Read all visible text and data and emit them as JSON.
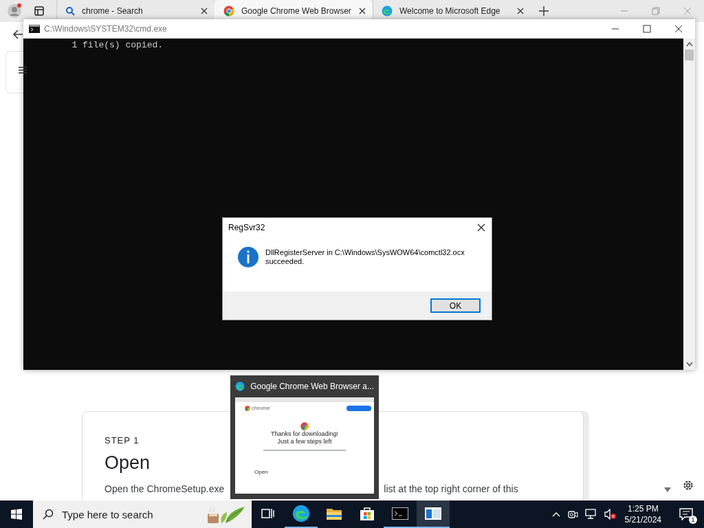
{
  "browser": {
    "tabs": [
      {
        "label": "chrome - Search",
        "kind": "search",
        "selected": false
      },
      {
        "label": "Google Chrome Web Browser",
        "kind": "chrome",
        "selected": true
      },
      {
        "label": "Welcome to Microsoft Edge",
        "kind": "edge",
        "selected": false
      }
    ],
    "page": {
      "step": "STEP 1",
      "heading": "Open",
      "text_left": "Open the ChromeSetup.exe",
      "text_right": "list at the top right corner of this"
    }
  },
  "console": {
    "title": "C:\\Windows\\SYSTEM32\\cmd.exe",
    "lines": [
      "        1 file(s) copied."
    ]
  },
  "dialog": {
    "title": "RegSvr32",
    "message": "DllRegisterServer in C:\\Windows\\SysWOW64\\comctl32.ocx\nsucceeded.",
    "button": "OK"
  },
  "preview": {
    "title": "Google Chrome Web Browser a...",
    "logo": "chrome",
    "headline": [
      "Thanks for downloading!",
      "Just a few steps left"
    ],
    "step": "Open"
  },
  "taskbar": {
    "search": {
      "placeholder": "Type here to search"
    },
    "apps": [
      {
        "kind": "taskview",
        "active": false
      },
      {
        "kind": "edge",
        "active": true
      },
      {
        "kind": "folder",
        "active": false
      },
      {
        "kind": "store",
        "active": false
      },
      {
        "kind": "console",
        "active": true
      },
      {
        "kind": "window",
        "active": true
      }
    ],
    "time": "1:25 PM",
    "date": "5/21/2024",
    "notifications": "1"
  }
}
